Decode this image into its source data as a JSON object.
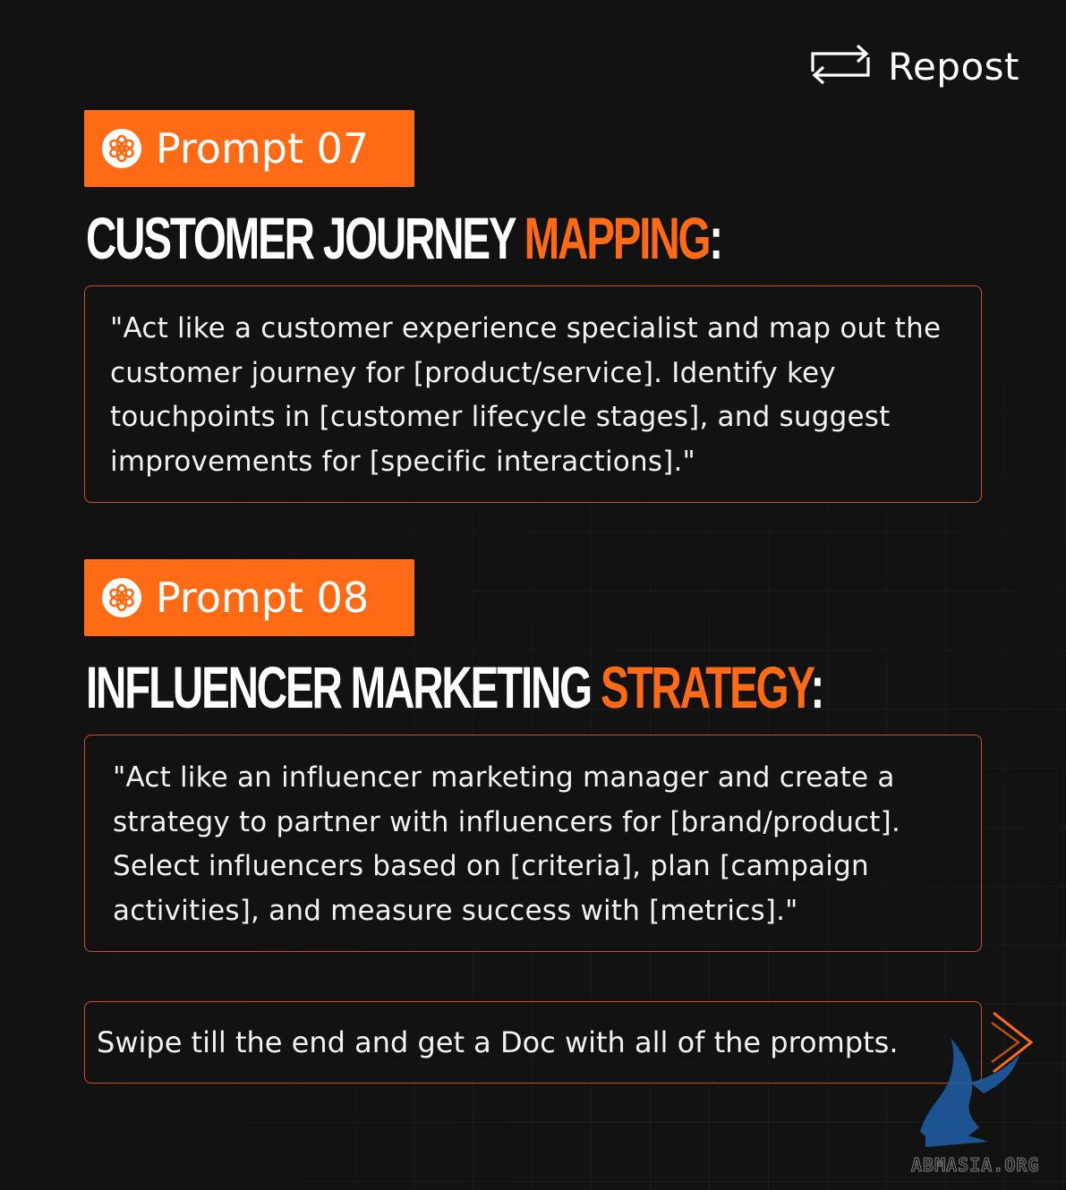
{
  "header": {
    "repost_label": "Repost",
    "repost_icon": "repost-icon"
  },
  "prompts": [
    {
      "badge": "Prompt 07",
      "title_main": "CUSTOMER JOURNEY ",
      "title_highlight": "MAPPING",
      "title_suffix": ":",
      "body": "\"Act like a customer experience specialist and map out the customer journey for [product/service]. Identify key touchpoints in [customer lifecycle stages], and suggest improvements for [specific interactions].\""
    },
    {
      "badge": "Prompt 08",
      "title_main": "INFLUENCER MARKETING ",
      "title_highlight": "STRATEGY",
      "title_suffix": ":",
      "body": "\"Act like an influencer marketing manager and create a strategy to partner with influencers for [brand/product]. Select influencers based on [criteria], plan [campaign activities], and measure success with [metrics].\""
    }
  ],
  "footer": {
    "swipe_text": "Swipe till the end and get a Doc with all of the prompts.",
    "next_icon": "chevron-right-icon"
  },
  "watermark": {
    "text": "ABMASIA.ORG"
  },
  "colors": {
    "background": "#121212",
    "accent": "#ff6a14",
    "border": "#c8531a",
    "text": "#ffffff"
  }
}
